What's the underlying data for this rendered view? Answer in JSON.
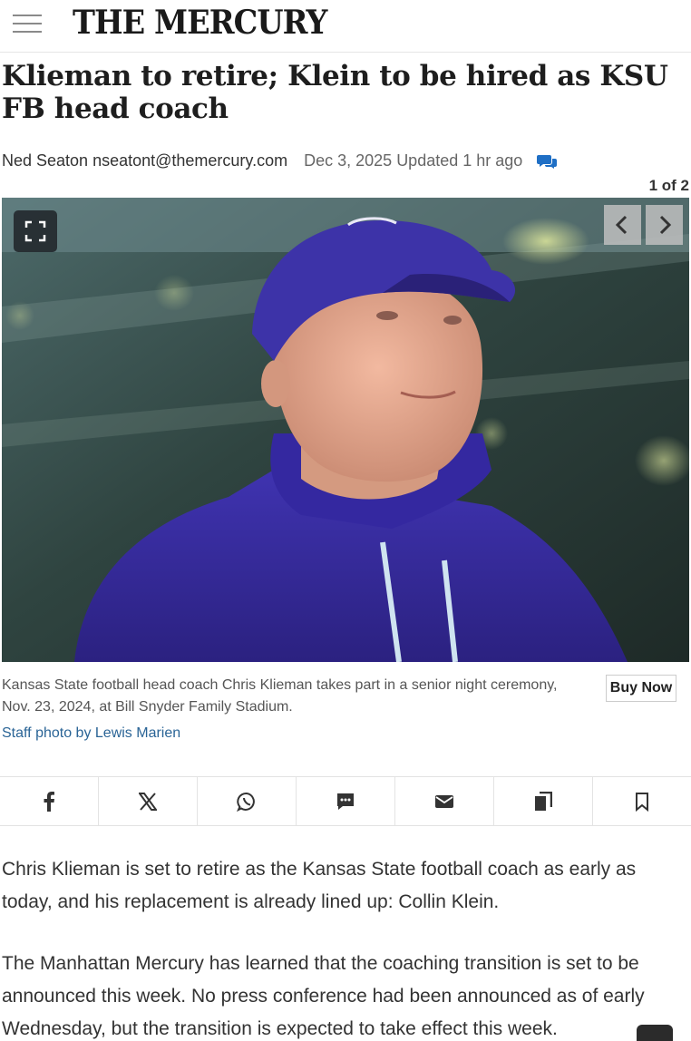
{
  "header": {
    "masthead": "THE MERCURY",
    "menu_icon": "hamburger-menu-icon"
  },
  "article": {
    "headline": "Klieman to retire; Klein to be hired as KSU FB head coach",
    "author": "Ned Seaton nseatont@themercury.com",
    "date": "Dec 3, 2025",
    "updated": "Updated 1 hr ago",
    "comment_icon": "comments-icon"
  },
  "gallery": {
    "counter": "1 of 2",
    "fullscreen_icon": "fullscreen-icon",
    "prev_icon": "chevron-left-icon",
    "next_icon": "chevron-right-icon",
    "caption": "Kansas State football head coach Chris Klieman takes part in a senior night ceremony, Nov. 23, 2024, at Bill Snyder Family Stadium.",
    "credit": "Staff photo by Lewis Marien",
    "buy_now": "Buy Now"
  },
  "share": {
    "icons": [
      "facebook-icon",
      "x-icon",
      "whatsapp-icon",
      "sms-icon",
      "email-icon",
      "copy-icon",
      "bookmark-icon"
    ]
  },
  "body": {
    "paragraphs": [
      "Chris Klieman is set to retire as the Kansas State football coach as early as today, and his replacement is already lined up: Collin Klein.",
      "The Manhattan Mercury has learned that the coaching transition is set to be announced this week. No press conference had been announced as of early Wednesday, but the transition is expected to take effect this week."
    ]
  },
  "colors": {
    "link": "#2a6496",
    "accent_blue": "#1f6fc5",
    "hoodie_purple": "#3a2fa0"
  }
}
